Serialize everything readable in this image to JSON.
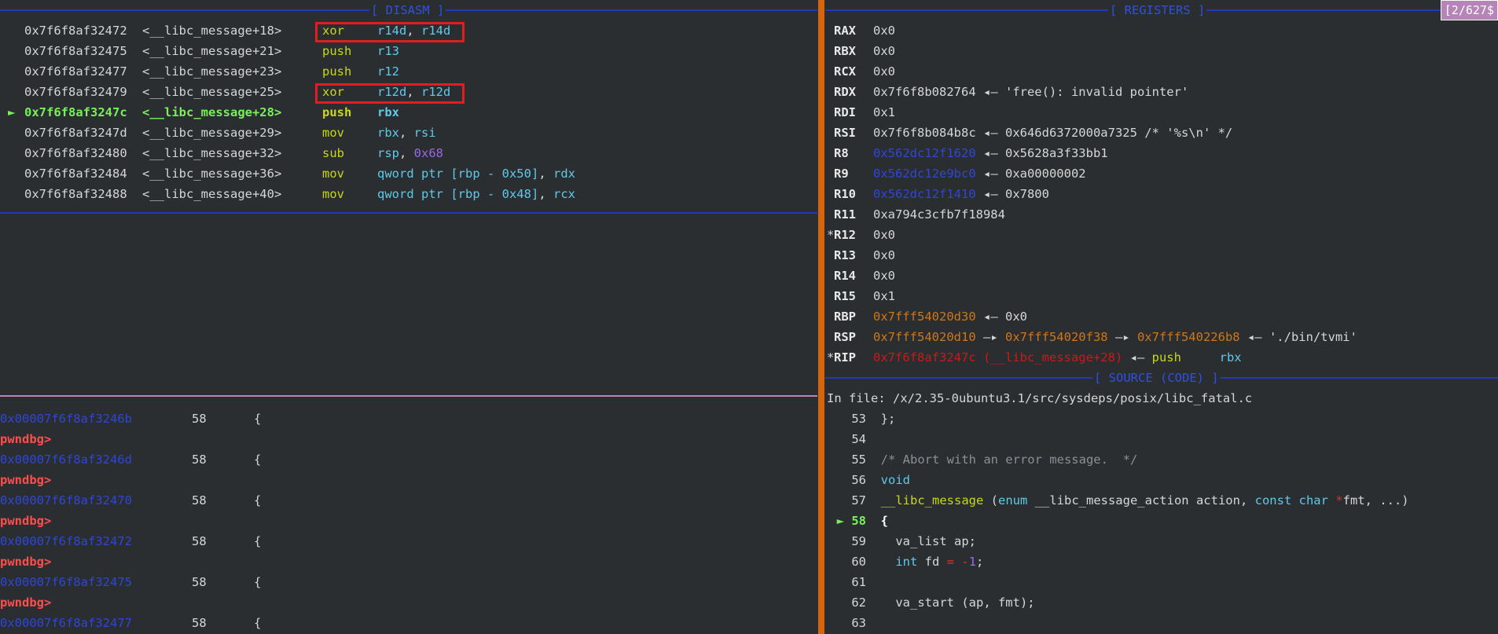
{
  "disasm": {
    "header": "[ DISASM ]",
    "rows": [
      {
        "arrow": "",
        "addr": "0x7f6f8af32472",
        "sym": "<__libc_message+18>",
        "op": "xor",
        "a1": "r14d",
        "sep": ", ",
        "a2": "r14d"
      },
      {
        "arrow": "",
        "addr": "0x7f6f8af32475",
        "sym": "<__libc_message+21>",
        "op": "push",
        "a1": "r13",
        "sep": "",
        "a2": ""
      },
      {
        "arrow": "",
        "addr": "0x7f6f8af32477",
        "sym": "<__libc_message+23>",
        "op": "push",
        "a1": "r12",
        "sep": "",
        "a2": ""
      },
      {
        "arrow": "",
        "addr": "0x7f6f8af32479",
        "sym": "<__libc_message+25>",
        "op": "xor",
        "a1": "r12d",
        "sep": ", ",
        "a2": "r12d"
      },
      {
        "arrow": "►",
        "addr": "0x7f6f8af3247c",
        "sym": "<__libc_message+28>",
        "op": "push",
        "a1": "rbx",
        "sep": "",
        "a2": ""
      },
      {
        "arrow": "",
        "addr": "0x7f6f8af3247d",
        "sym": "<__libc_message+29>",
        "op": "mov",
        "a1": "rbx",
        "sep": ", ",
        "a2": "rsi"
      },
      {
        "arrow": "",
        "addr": "0x7f6f8af32480",
        "sym": "<__libc_message+32>",
        "op": "sub",
        "a1": "rsp",
        "sep": ", ",
        "a2": "0x68"
      },
      {
        "arrow": "",
        "addr": "0x7f6f8af32484",
        "sym": "<__libc_message+36>",
        "op": "mov",
        "a1": "qword ptr [rbp - 0x50]",
        "sep": ", ",
        "a2": "rdx"
      },
      {
        "arrow": "",
        "addr": "0x7f6f8af32488",
        "sym": "<__libc_message+40>",
        "op": "mov",
        "a1": "qword ptr [rbp - 0x48]",
        "sep": ", ",
        "a2": "rcx"
      }
    ]
  },
  "registers": {
    "header": "[ REGISTERS ]",
    "counter": "[2/627$",
    "rows": [
      {
        "mark": "",
        "name": "RAX",
        "v": "0x0"
      },
      {
        "mark": "",
        "name": "RBX",
        "v": "0x0"
      },
      {
        "mark": "",
        "name": "RCX",
        "v": "0x0"
      },
      {
        "mark": "",
        "name": "RDX",
        "v": "0x7f6f8b082764",
        "rest": " ◂— 'free(): invalid pointer'"
      },
      {
        "mark": "",
        "name": "RDI",
        "v": "0x1"
      },
      {
        "mark": "",
        "name": "RSI",
        "v": "0x7f6f8b084b8c",
        "rest": " ◂— 0x646d6372000a7325 /* '%s\\n' */"
      },
      {
        "mark": "",
        "name": "R8",
        "heap": "0x562dc12f1620",
        "rest": " ◂— 0x5628a3f33bb1"
      },
      {
        "mark": "",
        "name": "R9",
        "heap": "0x562dc12e9bc0",
        "rest": " ◂— 0xa00000002"
      },
      {
        "mark": "",
        "name": "R10",
        "heap": "0x562dc12f1410",
        "rest": " ◂— 0x7800"
      },
      {
        "mark": "",
        "name": "R11",
        "v": "0xa794c3cfb7f18984"
      },
      {
        "mark": "*",
        "name": "R12",
        "v": "0x0"
      },
      {
        "mark": "",
        "name": "R13",
        "v": "0x0"
      },
      {
        "mark": "",
        "name": "R14",
        "v": "0x0"
      },
      {
        "mark": "",
        "name": "R15",
        "v": "0x1"
      },
      {
        "mark": "",
        "name": "RBP",
        "stack": "0x7fff54020d30",
        "rest": " ◂— 0x0"
      },
      {
        "mark": "",
        "name": "RSP",
        "stack": "0x7fff54020d10",
        "arr1": " —▸ ",
        "stack2": "0x7fff54020f38",
        "arr2": " —▸ ",
        "stack3": "0x7fff540226b8",
        "rest": " ◂— './bin/tvmi'"
      },
      {
        "mark": "*",
        "name": "RIP",
        "code": "0x7f6f8af3247c (__libc_message+28)",
        "rest": " ◂— ",
        "op": "push",
        "reg": "rbx"
      }
    ]
  },
  "source": {
    "header": "[ SOURCE (CODE) ]",
    "file_line": "In file: /x/2.35-0ubuntu3.1/src/sysdeps/posix/libc_fatal.c",
    "lines": [
      {
        "n": "53",
        "cur": false
      },
      {
        "n": "54",
        "cur": false
      },
      {
        "n": "55",
        "cur": false
      },
      {
        "n": "56",
        "cur": false
      },
      {
        "n": "57",
        "cur": false
      },
      {
        "n": "58",
        "cur": true
      },
      {
        "n": "59",
        "cur": false
      },
      {
        "n": "60",
        "cur": false
      },
      {
        "n": "61",
        "cur": false
      },
      {
        "n": "62",
        "cur": false
      },
      {
        "n": "63",
        "cur": false
      }
    ],
    "text": {
      "l53": "};",
      "l55": "/* Abort with an error message.  */",
      "l56": "void",
      "l57a": "__libc_message",
      "l57b": " (",
      "l57c": "enum",
      "l57d": " __libc_message_action action, ",
      "l57e": "const",
      "l57f": " ",
      "l57g": "char",
      "l57h": " ",
      "l57i": "*",
      "l57j": "fmt, ...)",
      "l58": "{",
      "l59": "  va_list ap;",
      "l60a": "  ",
      "l60b": "int",
      "l60c": " fd ",
      "l60d": "=",
      "l60e": " ",
      "l60f": "-",
      "l60g": "1",
      "l60h": ";",
      "l62": "  va_start (ap, fmt);",
      "cur_arrow": "►"
    }
  },
  "console": {
    "prompt": "pwndbg>",
    "rows": [
      {
        "addr": "0x00007f6f8af3246b",
        "line": "58",
        "code": "{"
      },
      {
        "addr": "0x00007f6f8af3246d",
        "line": "58",
        "code": "{"
      },
      {
        "addr": "0x00007f6f8af32470",
        "line": "58",
        "code": "{"
      },
      {
        "addr": "0x00007f6f8af32472",
        "line": "58",
        "code": "{"
      },
      {
        "addr": "0x00007f6f8af32475",
        "line": "58",
        "code": "{"
      },
      {
        "addr": "0x00007f6f8af32477",
        "line": "58",
        "code": "{"
      }
    ]
  }
}
